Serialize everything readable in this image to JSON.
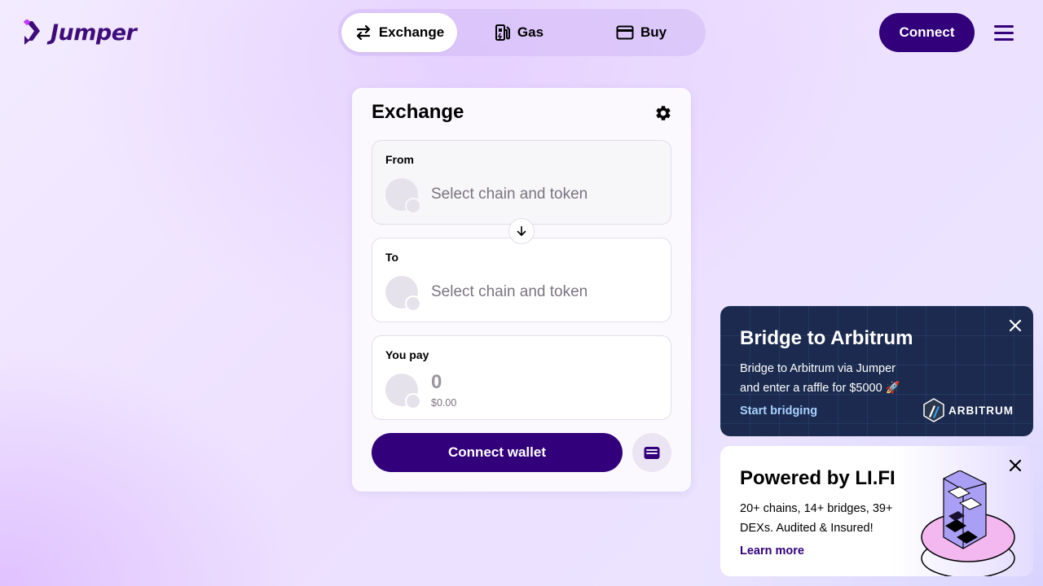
{
  "header": {
    "logo_text": "Jumper",
    "nav": [
      {
        "label": "Exchange",
        "icon": "swap-arrows-icon",
        "active": true
      },
      {
        "label": "Gas",
        "icon": "gas-pump-icon",
        "active": false
      },
      {
        "label": "Buy",
        "icon": "credit-card-icon",
        "active": false
      }
    ],
    "connect_label": "Connect",
    "brand_color": "#31007a"
  },
  "widget": {
    "title": "Exchange",
    "from": {
      "label": "From",
      "placeholder": "Select chain and token"
    },
    "to": {
      "label": "To",
      "placeholder": "Select chain and token"
    },
    "pay": {
      "label": "You pay",
      "amount": "0",
      "usd": "$0.00"
    },
    "connect_wallet_label": "Connect wallet"
  },
  "promos": {
    "arbitrum": {
      "title": "Bridge to Arbitrum",
      "desc_line1": "Bridge to Arbitrum via Jumper",
      "desc_line2": "and enter a raffle for $5000 🚀",
      "link": "Start bridging",
      "logo_text": "ARBITRUM"
    },
    "lifi": {
      "title": "Powered by LI.FI",
      "desc_line1": "20+ chains, 14+ bridges, 39+",
      "desc_line2": "DEXs. Audited & Insured!",
      "link": "Learn more"
    }
  }
}
